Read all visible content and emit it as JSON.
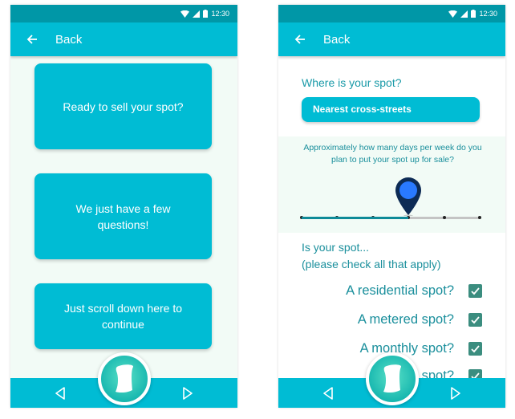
{
  "status_bar": {
    "time": "12:30"
  },
  "screen1": {
    "back_label": "Back",
    "cards": [
      "Ready to sell your spot?",
      "We just have a few questions!",
      "Just scroll down here to continue"
    ]
  },
  "screen2": {
    "back_label": "Back",
    "location_question": "Where is your spot?",
    "location_button": "Nearest cross-streets",
    "days_question": "Approximately how many days per week do you plan to put your spot up for sale?",
    "days_slider": {
      "min": 0,
      "max": 5,
      "value": 3
    },
    "spot_type_question": "Is your spot...\n(please check all that apply)",
    "spot_types": [
      {
        "label": "A residential spot?",
        "checked": true
      },
      {
        "label": "A metered spot?",
        "checked": true
      },
      {
        "label": "A monthly spot?",
        "checked": true
      },
      {
        "label": "A private spot?",
        "checked": true
      }
    ]
  },
  "icons": {
    "back": "arrow-left-icon",
    "prev": "triangle-left-icon",
    "next": "triangle-right-icon",
    "fab": "app-logo-icon",
    "wifi": "wifi-icon",
    "signal": "signal-icon",
    "battery": "battery-icon",
    "checkbox": "check-icon"
  },
  "colors": {
    "primary": "#00bcd4",
    "status_bar": "#0097a7",
    "background": "#f2fbf6",
    "checkbox": "#3b8d7f",
    "pin": "#0d2b55",
    "pin_dot": "#2979ff"
  }
}
